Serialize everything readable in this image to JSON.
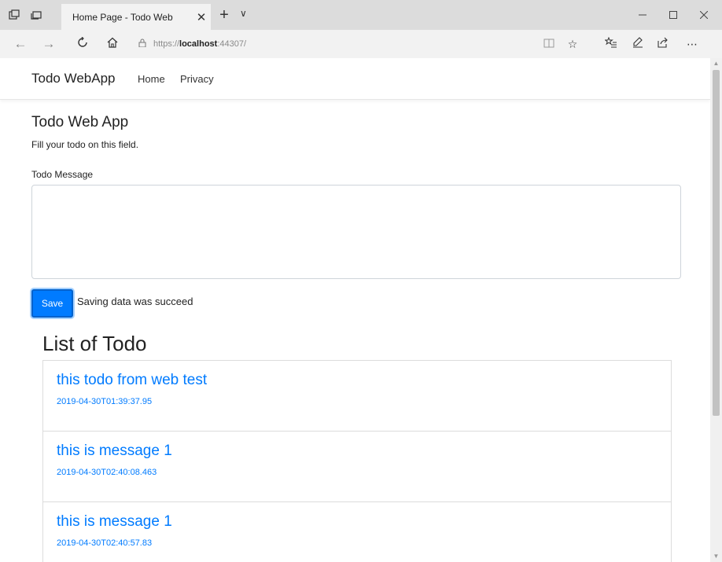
{
  "browser": {
    "tab_title": "Home Page - Todo Web",
    "tab_close": "✕",
    "new_tab": "+",
    "tab_list": "∨",
    "url_scheme": "https://",
    "url_host": "localhost",
    "url_rest": ":44307/",
    "icons": {
      "set_aside_tabs": "tabs-icon",
      "tab_preview": "preview-icon",
      "back": "back-arrow-icon",
      "forward": "forward-arrow-icon",
      "refresh": "refresh-icon",
      "home": "home-icon",
      "lock": "lock-icon",
      "reading_view": "reading-view-icon",
      "favorite": "star-icon",
      "favorites_hub": "favorites-hub-icon",
      "notes": "pen-icon",
      "share": "share-icon",
      "more": "more-icon"
    }
  },
  "navbar": {
    "brand": "Todo WebApp",
    "links": [
      "Home",
      "Privacy"
    ]
  },
  "page": {
    "heading": "Todo Web App",
    "subheading": "Fill your todo on this field.",
    "field_label": "Todo Message",
    "textarea_value": "",
    "save_label": "Save",
    "status_text": "Saving data was succeed"
  },
  "list": {
    "title": "List of Todo",
    "items": [
      {
        "message": "this todo from web test",
        "timestamp": "2019-04-30T01:39:37.95"
      },
      {
        "message": "this is message 1",
        "timestamp": "2019-04-30T02:40:08.463"
      },
      {
        "message": "this is message 1",
        "timestamp": "2019-04-30T02:40:57.83"
      }
    ]
  },
  "colors": {
    "primary": "#007bff",
    "chrome_bg": "#dcdcdc",
    "address_bg": "#f2f2f2"
  }
}
